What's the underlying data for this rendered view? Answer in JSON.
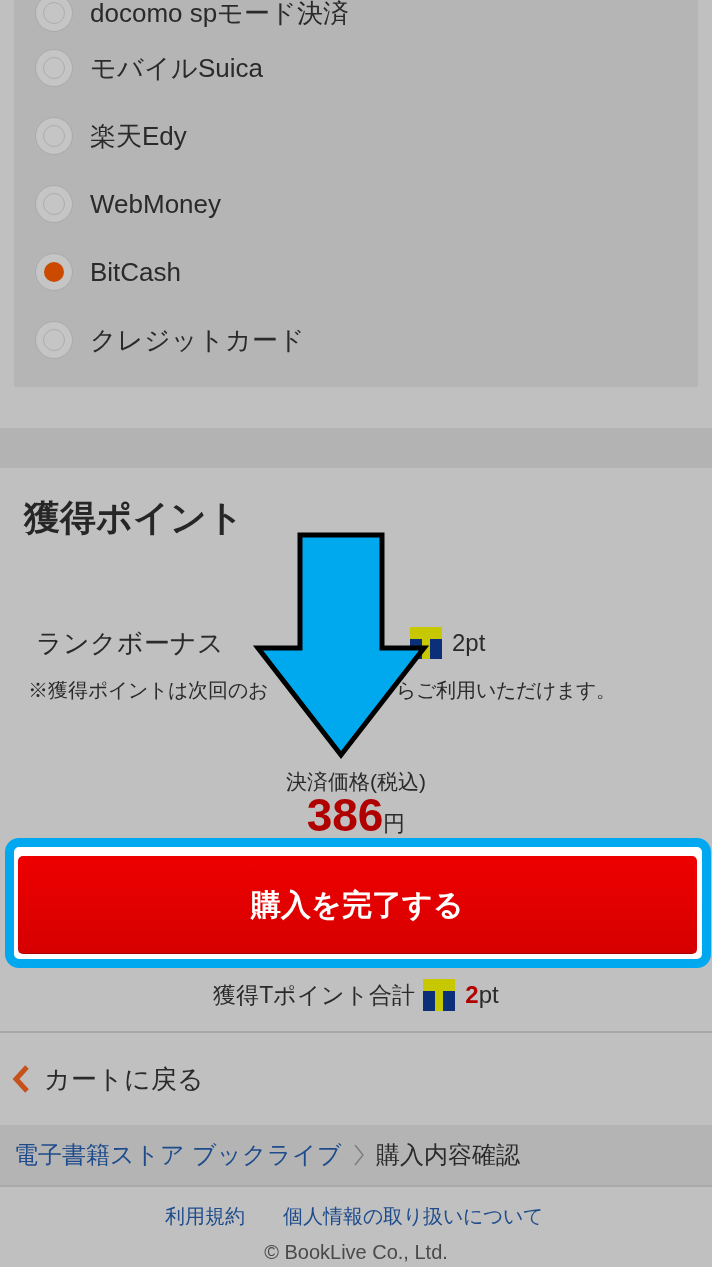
{
  "payment_methods": [
    {
      "label": "docomo spモード決済",
      "selected": false
    },
    {
      "label": "モバイルSuica",
      "selected": false
    },
    {
      "label": "楽天Edy",
      "selected": false
    },
    {
      "label": "WebMoney",
      "selected": false
    },
    {
      "label": "BitCash",
      "selected": true
    },
    {
      "label": "クレジットカード",
      "selected": false
    }
  ],
  "points_section": {
    "title": "獲得ポイント",
    "rank_bonus": {
      "label": "ランクボーナス",
      "points": "2pt"
    },
    "note_parts": [
      "※獲得ポイントは次回のお",
      "らご利用いただけます。"
    ]
  },
  "price": {
    "label": "決済価格(税込)",
    "amount": "386",
    "currency": "円"
  },
  "purchase_button": {
    "label": "購入を完了する"
  },
  "total_points": {
    "label": "獲得Tポイント合計",
    "value": "2",
    "unit": "pt"
  },
  "back_link": {
    "label": "カートに戻る"
  },
  "breadcrumb": [
    {
      "label": "電子書籍ストア ブックライブ",
      "kind": "link"
    },
    {
      "label": "購入内容確認",
      "kind": "current"
    }
  ],
  "footer": {
    "links": [
      "利用規約",
      "個人情報の取り扱いについて"
    ],
    "copyright": "© BookLive Co., Ltd."
  }
}
